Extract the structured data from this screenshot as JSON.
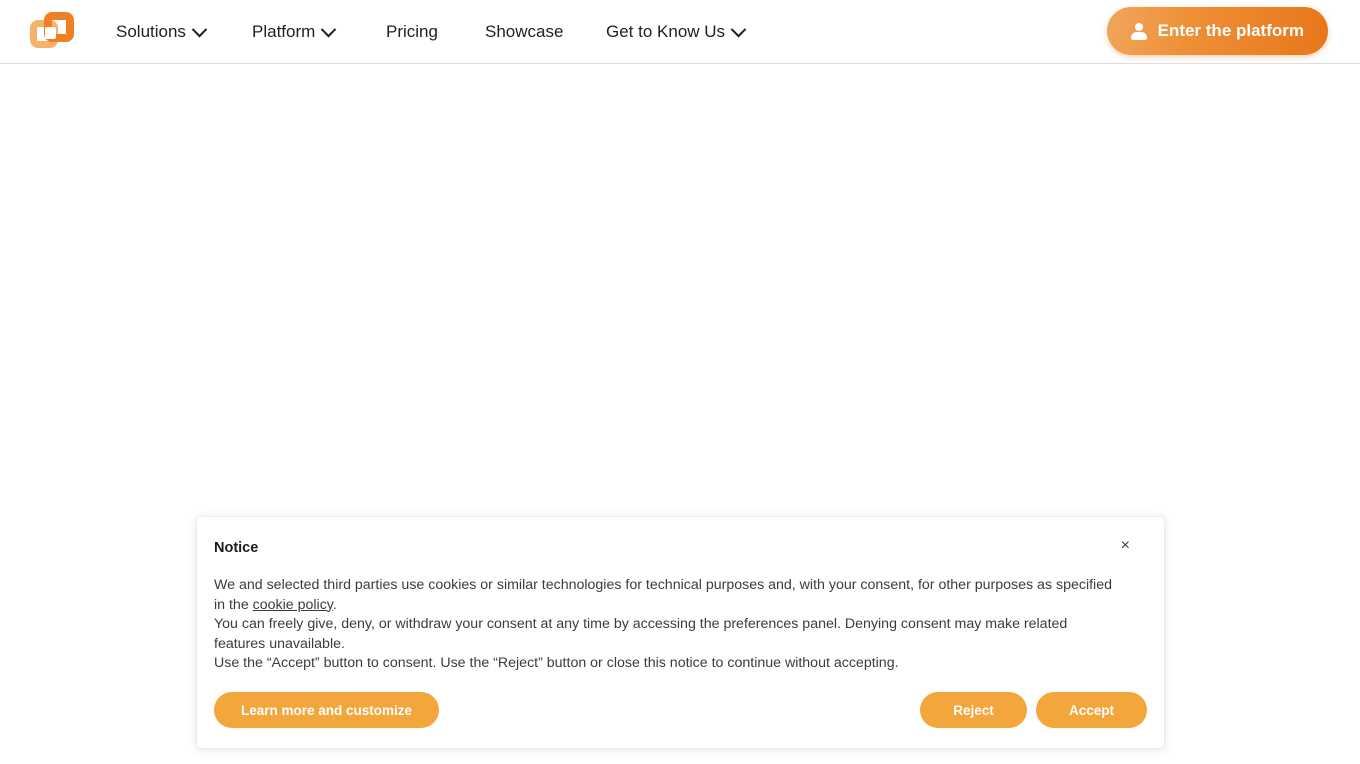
{
  "header": {
    "logo": {
      "name": "company-logo",
      "colors": {
        "light": "#f6b16a",
        "dark": "#ee7f26"
      }
    },
    "nav": [
      {
        "label": "Solutions",
        "has_dropdown": true
      },
      {
        "label": "Platform",
        "has_dropdown": true
      },
      {
        "label": "Pricing",
        "has_dropdown": false
      },
      {
        "label": "Showcase",
        "has_dropdown": false
      },
      {
        "label": "Get to Know Us",
        "has_dropdown": true
      }
    ],
    "cta": {
      "label": "Enter the platform",
      "icon": "user-icon",
      "gradient_from": "#f0a65c",
      "gradient_to": "#e8761a"
    }
  },
  "cookie_notice": {
    "title": "Notice",
    "close_label": "×",
    "paragraph_1_before_link": "We and selected third parties use cookies or similar technologies for technical purposes and, with your consent, for other purposes as specified in the ",
    "link_text": "cookie policy",
    "paragraph_1_after_link": ".",
    "paragraph_2": "You can freely give, deny, or withdraw your consent at any time by accessing the preferences panel. Denying consent may make related features unavailable.",
    "paragraph_3": "Use the “Accept” button to consent. Use the “Reject” button or close this notice to continue without accepting.",
    "buttons": {
      "learn_more": "Learn more and customize",
      "reject": "Reject",
      "accept": "Accept"
    },
    "accent_color": "#f2a63c"
  }
}
